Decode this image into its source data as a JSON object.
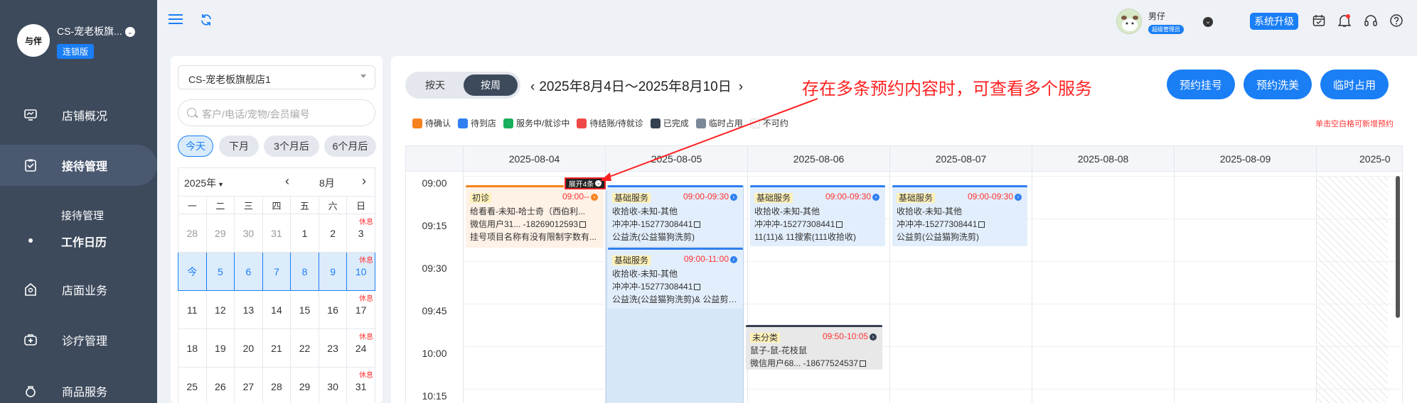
{
  "sidebar": {
    "logo_text": "与伴",
    "store_name": "CS-宠老板旗...",
    "badge": "连锁版",
    "menu": [
      {
        "label": "店铺概况",
        "icon": "monitor-icon"
      },
      {
        "label": "接待管理",
        "icon": "clipboard-icon"
      },
      {
        "label": "店面业务",
        "icon": "shop-icon"
      },
      {
        "label": "诊疗管理",
        "icon": "medical-kit-icon"
      },
      {
        "label": "商品服务",
        "icon": "bag-icon"
      }
    ],
    "submenu": [
      "接待管理",
      "工作日历"
    ]
  },
  "topbar": {
    "user_name": "男仔",
    "user_role": "超级管理员",
    "upgrade_label": "系统升级"
  },
  "calendar": {
    "store_select": "CS-宠老板旗舰店1",
    "search_placeholder": "客户/电话/宠物/会员编号",
    "quick_ranges": [
      "今天",
      "下月",
      "3个月后",
      "6个月后"
    ],
    "year": "2025年",
    "month": "8月",
    "weekdays": [
      "一",
      "二",
      "三",
      "四",
      "五",
      "六",
      "日"
    ],
    "rest_label": "休息",
    "weeks": [
      [
        "28",
        "29",
        "30",
        "31",
        "1",
        "2",
        "3"
      ],
      [
        "今",
        "5",
        "6",
        "7",
        "8",
        "9",
        "10"
      ],
      [
        "11",
        "12",
        "13",
        "14",
        "15",
        "16",
        "17"
      ],
      [
        "18",
        "19",
        "20",
        "21",
        "22",
        "23",
        "24"
      ],
      [
        "25",
        "26",
        "27",
        "28",
        "29",
        "30",
        "31"
      ]
    ]
  },
  "schedule": {
    "view_day": "按天",
    "view_week": "按周",
    "range": "2025年8月4日～2025年8月10日",
    "buttons": [
      "预约挂号",
      "预约洗美",
      "临时占用"
    ],
    "legend": [
      {
        "label": "待确认",
        "color": "#f5821f"
      },
      {
        "label": "待到店",
        "color": "#2f7ff0"
      },
      {
        "label": "服务中/就诊中",
        "color": "#1aaf5d"
      },
      {
        "label": "待结账/待就诊",
        "color": "#f04848"
      },
      {
        "label": "已完成",
        "color": "#34404f"
      },
      {
        "label": "临时占用",
        "color": "#7b8896"
      },
      {
        "label": "不可约",
        "color": "#e2e2e2"
      }
    ],
    "hint": "单击空白格可新增预约",
    "annotation": "存在多条预约内容时，可查看多个服务",
    "expand_label": "展开4条",
    "dates": [
      "2025-08-04",
      "2025-08-05",
      "2025-08-06",
      "2025-08-07",
      "2025-08-08",
      "2025-08-09",
      "2025-0"
    ],
    "times": [
      "09:00",
      "09:15",
      "09:30",
      "09:45",
      "10:00",
      "10:15"
    ],
    "cards": [
      {
        "tag": "初诊",
        "time": "09:00--",
        "lines": [
          "给看看-未知-哈士奇（西伯利...",
          "微信用户31...  -18269012593",
          "挂号项目名称有没有限制字数有..."
        ],
        "color": "#f5821f"
      },
      {
        "tag": "基础服务",
        "time": "09:00-09:30",
        "lines": [
          "收拾收-未知-其他",
          "冲冲冲-15277308441",
          "公益洗(公益猫狗洗剪)"
        ],
        "color": "#2f7ff0"
      },
      {
        "tag": "基础服务",
        "time": "09:00-11:00",
        "lines": [
          "收拾收-未知-其他",
          "冲冲冲-15277308441",
          "公益洗(公益猫狗洗剪)& 公益剪(..."
        ],
        "color": "#2f7ff0"
      },
      {
        "tag": "基础服务",
        "time": "09:00-09:30",
        "lines": [
          "收拾收-未知-其他",
          "冲冲冲-15277308441",
          "11(11)& 11搜索(111收拾收)"
        ],
        "color": "#2f7ff0"
      },
      {
        "tag": "基础服务",
        "time": "09:00-09:30",
        "lines": [
          "收拾收-未知-其他",
          "冲冲冲-15277308441",
          "公益剪(公益猫狗洗剪)"
        ],
        "color": "#2f7ff0"
      },
      {
        "tag": "未分类",
        "time": "09:50-10:05",
        "lines": [
          "鼠子-鼠-花枝鼠",
          "微信用户68...  -18677524537"
        ],
        "color": "#34404f"
      }
    ]
  }
}
